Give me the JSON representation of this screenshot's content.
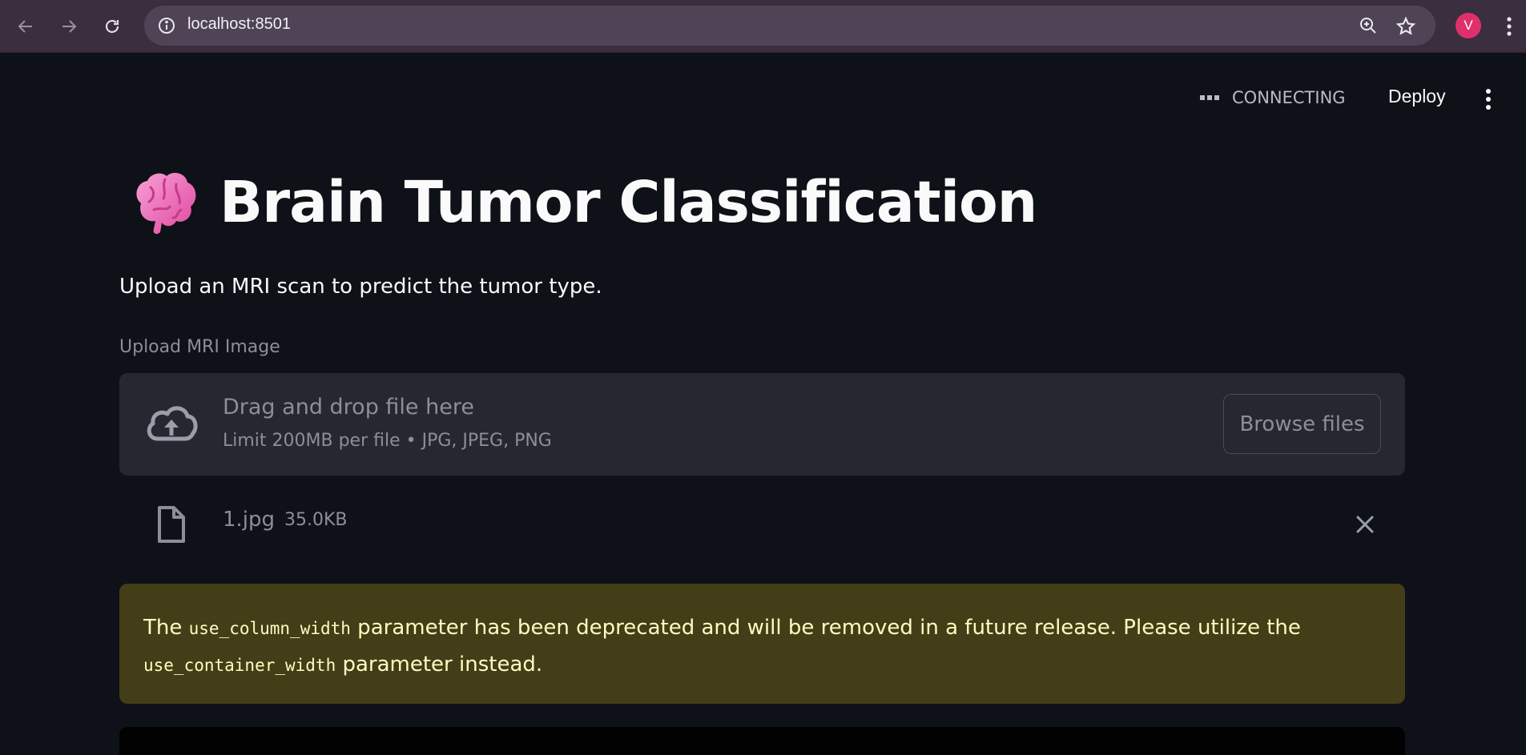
{
  "browser": {
    "url": "localhost:8501",
    "profile_initial": "V"
  },
  "header": {
    "status": "CONNECTING",
    "deploy_label": "Deploy"
  },
  "main": {
    "title": "Brain Tumor Classification",
    "subtitle": "Upload an MRI scan to predict the tumor type.",
    "uploader": {
      "label": "Upload MRI Image",
      "drag_text": "Drag and drop file here",
      "limit_text": "Limit 200MB per file • JPG, JPEG, PNG",
      "browse_label": "Browse files"
    },
    "file": {
      "name": "1.jpg",
      "size": "35.0KB"
    },
    "warning": {
      "part1": "The ",
      "code1": "use_column_width",
      "part2": " parameter has been deprecated and will be removed in a future release. Please utilize the",
      "code2": "use_container_width",
      "part3": " parameter instead."
    }
  },
  "colors": {
    "background": "#0e1117",
    "chrome": "#3a2e3f",
    "dropzone": "#262730",
    "warning_bg": "#433e17",
    "warning_text": "#fffcc2",
    "profile": "#e0306c"
  }
}
